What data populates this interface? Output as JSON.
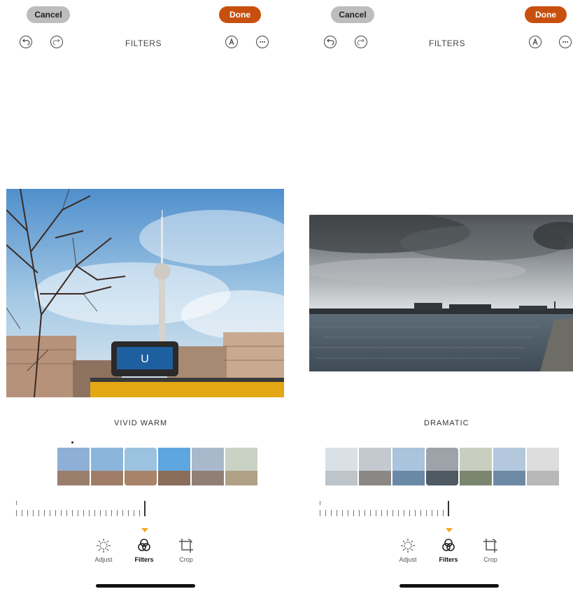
{
  "left": {
    "cancel_label": "Cancel",
    "done_label": "Done",
    "section_title": "FILTERS",
    "filter_name": "VIVID WARM"
  },
  "right": {
    "cancel_label": "Cancel",
    "done_label": "Done",
    "section_title": "FILTERS",
    "filter_name": "DRAMATIC"
  },
  "toolbar": {
    "adjust_label": "Adjust",
    "filters_label": "Filters",
    "crop_label": "Crop"
  },
  "colors": {
    "done": "#c8500f",
    "cancel": "#bdbdbd",
    "indicator": "#f2a81d"
  },
  "icons": [
    "undo-icon",
    "redo-icon",
    "markup-icon",
    "more-icon",
    "adjust-icon",
    "filters-icon",
    "crop-icon"
  ]
}
